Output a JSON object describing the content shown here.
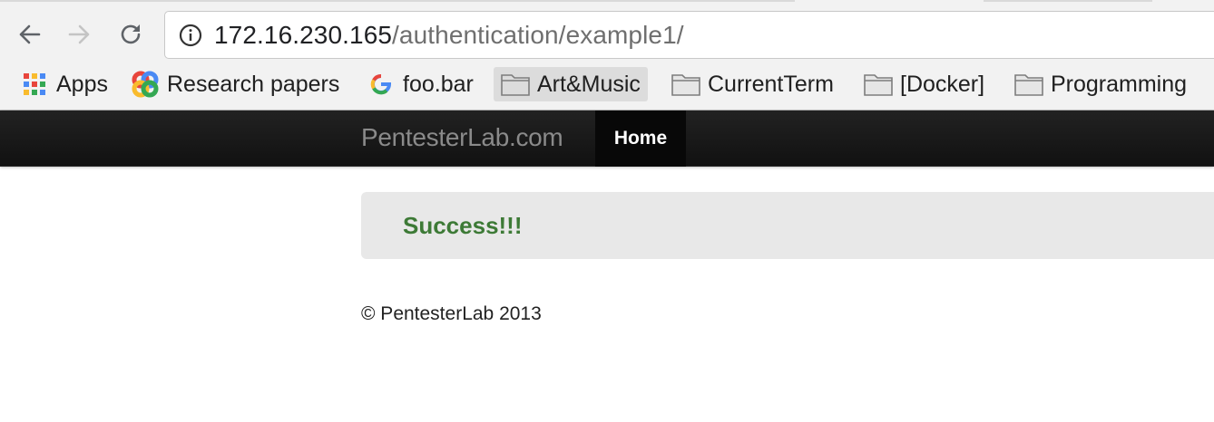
{
  "browser": {
    "url_host": "172.16.230.165",
    "url_path": "/authentication/example1/",
    "bookmarks": [
      {
        "label": "Apps",
        "icon": "apps-grid-icon"
      },
      {
        "label": "Research papers",
        "icon": "google-scholar-icon"
      },
      {
        "label": "foo.bar",
        "icon": "google-icon"
      },
      {
        "label": "Art&Music",
        "icon": "folder-icon"
      },
      {
        "label": "CurrentTerm",
        "icon": "folder-icon"
      },
      {
        "label": "[Docker]",
        "icon": "folder-icon"
      },
      {
        "label": "Programming",
        "icon": "folder-icon"
      }
    ]
  },
  "page": {
    "brand": "PentesterLab.com",
    "nav_home": "Home",
    "alert_text": "Success!!!",
    "footer": "© PentesterLab 2013"
  },
  "colors": {
    "navbar": "#1b1b1b",
    "success_text": "#3d7a36",
    "alert_bg": "#e8e8e8"
  }
}
